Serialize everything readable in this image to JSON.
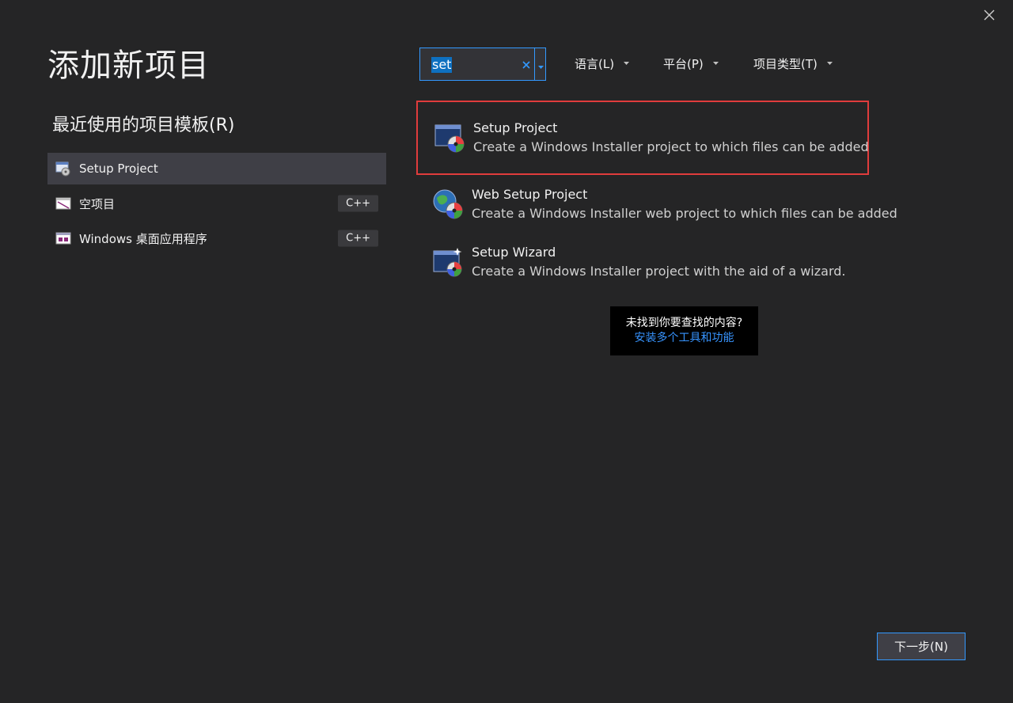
{
  "dialog": {
    "title": "添加新项目",
    "close_icon": "close-icon"
  },
  "recent": {
    "heading": "最近使用的项目模板(R)",
    "items": [
      {
        "label": "Setup Project",
        "tag": "",
        "icon": "setup-project-icon"
      },
      {
        "label": "空项目",
        "tag": "C++",
        "icon": "empty-project-icon"
      },
      {
        "label": "Windows 桌面应用程序",
        "tag": "C++",
        "icon": "desktop-app-icon"
      }
    ]
  },
  "search": {
    "value": "set",
    "clear_icon": "clear-icon",
    "dropdown_icon": "chevron-down-icon"
  },
  "filters": {
    "language": "语言(L)",
    "platform": "平台(P)",
    "project_type": "项目类型(T)"
  },
  "results": [
    {
      "name": "Setup Project",
      "description": "Create a Windows Installer project to which files can be added",
      "icon": "setup-project-icon"
    },
    {
      "name": "Web Setup Project",
      "description": "Create a Windows Installer web project to which files can be added",
      "icon": "web-setup-icon"
    },
    {
      "name": "Setup Wizard",
      "description": "Create a Windows Installer project with the aid of a wizard.",
      "icon": "setup-wizard-icon"
    }
  ],
  "not_found": {
    "question": "未找到你要查找的内容?",
    "link": "安装多个工具和功能"
  },
  "footer": {
    "next_label": "下一步(N)"
  },
  "colors": {
    "background": "#252526",
    "accent": "#3399ff",
    "selection_border": "#e03c3c",
    "link": "#3794ff"
  }
}
